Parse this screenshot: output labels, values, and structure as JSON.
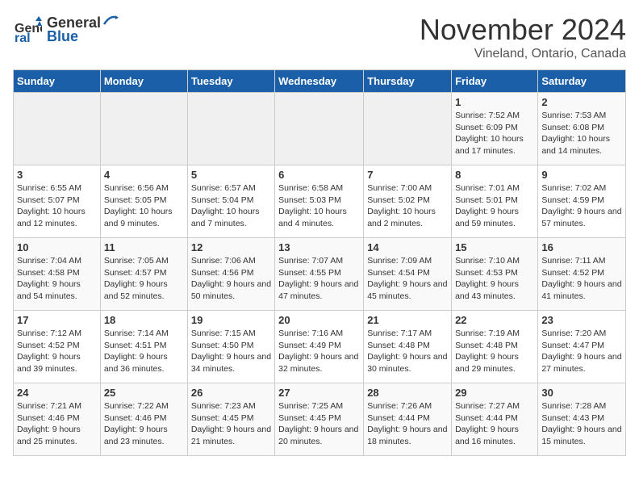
{
  "logo": {
    "line1": "General",
    "line2": "Blue"
  },
  "title": "November 2024",
  "location": "Vineland, Ontario, Canada",
  "days_header": [
    "Sunday",
    "Monday",
    "Tuesday",
    "Wednesday",
    "Thursday",
    "Friday",
    "Saturday"
  ],
  "weeks": [
    [
      {
        "day": "",
        "info": ""
      },
      {
        "day": "",
        "info": ""
      },
      {
        "day": "",
        "info": ""
      },
      {
        "day": "",
        "info": ""
      },
      {
        "day": "",
        "info": ""
      },
      {
        "day": "1",
        "info": "Sunrise: 7:52 AM\nSunset: 6:09 PM\nDaylight: 10 hours and 17 minutes."
      },
      {
        "day": "2",
        "info": "Sunrise: 7:53 AM\nSunset: 6:08 PM\nDaylight: 10 hours and 14 minutes."
      }
    ],
    [
      {
        "day": "3",
        "info": "Sunrise: 6:55 AM\nSunset: 5:07 PM\nDaylight: 10 hours and 12 minutes."
      },
      {
        "day": "4",
        "info": "Sunrise: 6:56 AM\nSunset: 5:05 PM\nDaylight: 10 hours and 9 minutes."
      },
      {
        "day": "5",
        "info": "Sunrise: 6:57 AM\nSunset: 5:04 PM\nDaylight: 10 hours and 7 minutes."
      },
      {
        "day": "6",
        "info": "Sunrise: 6:58 AM\nSunset: 5:03 PM\nDaylight: 10 hours and 4 minutes."
      },
      {
        "day": "7",
        "info": "Sunrise: 7:00 AM\nSunset: 5:02 PM\nDaylight: 10 hours and 2 minutes."
      },
      {
        "day": "8",
        "info": "Sunrise: 7:01 AM\nSunset: 5:01 PM\nDaylight: 9 hours and 59 minutes."
      },
      {
        "day": "9",
        "info": "Sunrise: 7:02 AM\nSunset: 4:59 PM\nDaylight: 9 hours and 57 minutes."
      }
    ],
    [
      {
        "day": "10",
        "info": "Sunrise: 7:04 AM\nSunset: 4:58 PM\nDaylight: 9 hours and 54 minutes."
      },
      {
        "day": "11",
        "info": "Sunrise: 7:05 AM\nSunset: 4:57 PM\nDaylight: 9 hours and 52 minutes."
      },
      {
        "day": "12",
        "info": "Sunrise: 7:06 AM\nSunset: 4:56 PM\nDaylight: 9 hours and 50 minutes."
      },
      {
        "day": "13",
        "info": "Sunrise: 7:07 AM\nSunset: 4:55 PM\nDaylight: 9 hours and 47 minutes."
      },
      {
        "day": "14",
        "info": "Sunrise: 7:09 AM\nSunset: 4:54 PM\nDaylight: 9 hours and 45 minutes."
      },
      {
        "day": "15",
        "info": "Sunrise: 7:10 AM\nSunset: 4:53 PM\nDaylight: 9 hours and 43 minutes."
      },
      {
        "day": "16",
        "info": "Sunrise: 7:11 AM\nSunset: 4:52 PM\nDaylight: 9 hours and 41 minutes."
      }
    ],
    [
      {
        "day": "17",
        "info": "Sunrise: 7:12 AM\nSunset: 4:52 PM\nDaylight: 9 hours and 39 minutes."
      },
      {
        "day": "18",
        "info": "Sunrise: 7:14 AM\nSunset: 4:51 PM\nDaylight: 9 hours and 36 minutes."
      },
      {
        "day": "19",
        "info": "Sunrise: 7:15 AM\nSunset: 4:50 PM\nDaylight: 9 hours and 34 minutes."
      },
      {
        "day": "20",
        "info": "Sunrise: 7:16 AM\nSunset: 4:49 PM\nDaylight: 9 hours and 32 minutes."
      },
      {
        "day": "21",
        "info": "Sunrise: 7:17 AM\nSunset: 4:48 PM\nDaylight: 9 hours and 30 minutes."
      },
      {
        "day": "22",
        "info": "Sunrise: 7:19 AM\nSunset: 4:48 PM\nDaylight: 9 hours and 29 minutes."
      },
      {
        "day": "23",
        "info": "Sunrise: 7:20 AM\nSunset: 4:47 PM\nDaylight: 9 hours and 27 minutes."
      }
    ],
    [
      {
        "day": "24",
        "info": "Sunrise: 7:21 AM\nSunset: 4:46 PM\nDaylight: 9 hours and 25 minutes."
      },
      {
        "day": "25",
        "info": "Sunrise: 7:22 AM\nSunset: 4:46 PM\nDaylight: 9 hours and 23 minutes."
      },
      {
        "day": "26",
        "info": "Sunrise: 7:23 AM\nSunset: 4:45 PM\nDaylight: 9 hours and 21 minutes."
      },
      {
        "day": "27",
        "info": "Sunrise: 7:25 AM\nSunset: 4:45 PM\nDaylight: 9 hours and 20 minutes."
      },
      {
        "day": "28",
        "info": "Sunrise: 7:26 AM\nSunset: 4:44 PM\nDaylight: 9 hours and 18 minutes."
      },
      {
        "day": "29",
        "info": "Sunrise: 7:27 AM\nSunset: 4:44 PM\nDaylight: 9 hours and 16 minutes."
      },
      {
        "day": "30",
        "info": "Sunrise: 7:28 AM\nSunset: 4:43 PM\nDaylight: 9 hours and 15 minutes."
      }
    ]
  ]
}
